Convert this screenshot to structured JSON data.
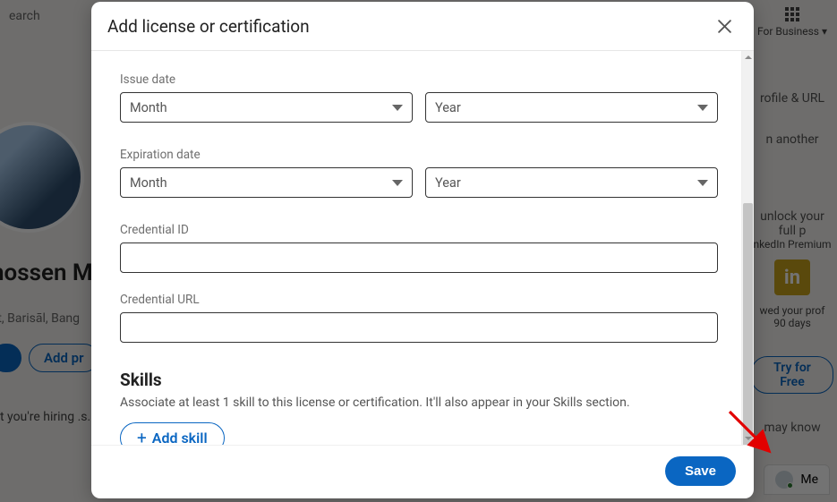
{
  "background": {
    "search_placeholder": "earch",
    "apps_label": "For Business ▾",
    "profile_name": "hossen M",
    "profile_sub": "ct, Barisāl, Bang",
    "pill_right": "Add pr",
    "hiring_line": "t you're hiring\n.s.\nd.",
    "right_link_1": "rofile & URL",
    "right_link_2": "n another",
    "premium_text_1": "unlock your full p",
    "premium_text_2": "nkedIn Premium",
    "in_label": "in",
    "viewed_text": "wed your prof",
    "days_text": "90 days",
    "try_free": "Try for Free",
    "may_know": "may know",
    "chat_label": "Me"
  },
  "modal": {
    "title": "Add license or certification",
    "issue_date_label": "Issue date",
    "expiration_date_label": "Expiration date",
    "month": "Month",
    "year": "Year",
    "credential_id_label": "Credential ID",
    "credential_id_value": "",
    "credential_url_label": "Credential URL",
    "credential_url_value": "",
    "skills_title": "Skills",
    "skills_desc": "Associate at least 1 skill to this license or certification. It'll also appear in your Skills section.",
    "add_skill": "Add skill",
    "save": "Save"
  }
}
